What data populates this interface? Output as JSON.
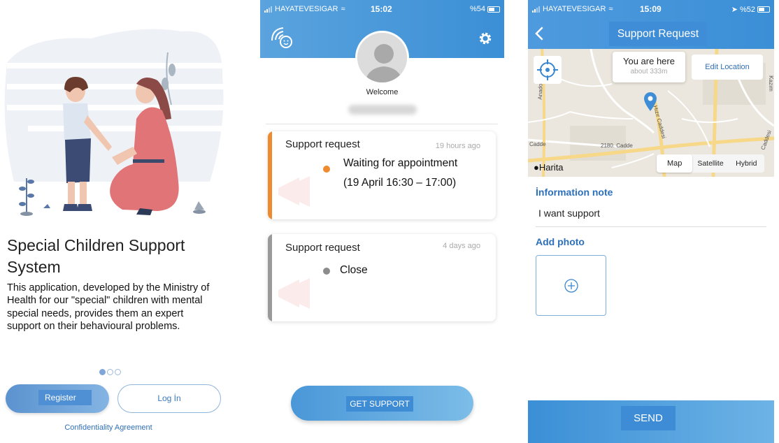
{
  "screen1": {
    "title": "Special Children Support System",
    "description": "This application, developed by the Ministry of Health for our \"special\" children with mental special needs, provides them an expert support on their behavioural problems.",
    "pager": {
      "count": 3,
      "active": 1
    },
    "register_label": "Register",
    "login_label": "Log İn",
    "confidentiality_label": "Confidentiality Agreement"
  },
  "screen2": {
    "status": {
      "carrier": "HAYATEVESIGAR",
      "time": "15:02",
      "battery": "%54"
    },
    "welcome": "Welcome",
    "requests": [
      {
        "title": "Support request",
        "time": "19 hours ago",
        "status_line1": "Waiting for appointment",
        "status_line2": "(19 April 16:30 – 17:00)",
        "status_color": "#ee8a2f"
      },
      {
        "title": "Support request",
        "time": "4 days ago",
        "status_line1": "Close",
        "status_color": "#8c8c8c"
      }
    ],
    "get_support_label": "GET SUPPORT"
  },
  "screen3": {
    "status": {
      "carrier": "HAYATEVESIGAR",
      "time": "15:09",
      "battery": "%52"
    },
    "title": "Support Request",
    "map": {
      "popup_title": "You are here",
      "popup_subtitle": "about 333m",
      "edit_location": "Edit Location",
      "attribution": "Harita",
      "types": [
        "Map",
        "Satellite",
        "Hybrid"
      ],
      "selected_type": "Map",
      "street_labels": [
        "2180. Cadde",
        "Cadde",
        "Anadolu Bulvarı",
        "Hızır Caddesi",
        "Caddesi",
        "Kazım"
      ]
    },
    "info_label": "İnformation note",
    "info_value": "I want support",
    "photo_label": "Add photo",
    "send_label": "SEND"
  }
}
